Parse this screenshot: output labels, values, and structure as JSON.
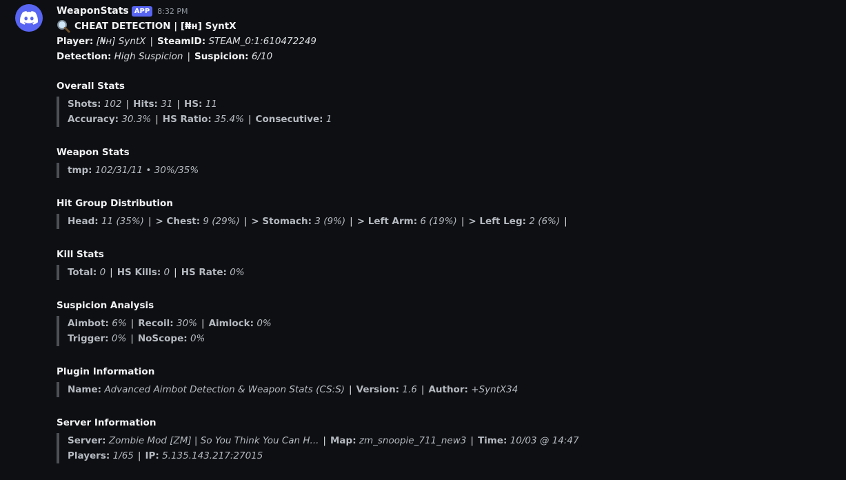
{
  "message": {
    "author": "WeaponStats",
    "badge": "APP",
    "timestamp": "8:32 PM",
    "title": "CHEAT DETECTION | [₦ʜ] SyntX",
    "player_label": "Player:",
    "player_value": "[₦ʜ] SyntX",
    "steamid_label": "SteamID:",
    "steamid_value": "STEAM_0:1:610472249",
    "detection_label": "Detection:",
    "detection_value": "High Suspicion",
    "suspicion_label": "Suspicion:",
    "suspicion_value": "6/10"
  },
  "overall": {
    "title": "Overall Stats",
    "shots_label": "Shots:",
    "shots": "102",
    "hits_label": "Hits:",
    "hits": "31",
    "hs_label": "HS:",
    "hs": "11",
    "accuracy_label": "Accuracy:",
    "accuracy": "30.3%",
    "hsratio_label": "HS Ratio:",
    "hsratio": "35.4%",
    "consecutive_label": "Consecutive:",
    "consecutive": "1"
  },
  "weapon": {
    "title": "Weapon Stats",
    "label": "tmp:",
    "value": "102/31/11 • 30%/35%"
  },
  "hitgroup": {
    "title": "Hit Group Distribution",
    "head_label": "Head:",
    "head": "11 (35%)",
    "chest_label": "> Chest:",
    "chest": "9 (29%)",
    "stomach_label": "> Stomach:",
    "stomach": "3 (9%)",
    "leftarm_label": "> Left Arm:",
    "leftarm": "6 (19%)",
    "leftleg_label": "> Left Leg:",
    "leftleg": "2 (6%)"
  },
  "kills": {
    "title": "Kill Stats",
    "total_label": "Total:",
    "total": "0",
    "hskills_label": "HS Kills:",
    "hskills": "0",
    "hsrate_label": "HS Rate:",
    "hsrate": "0%"
  },
  "suspicion": {
    "title": "Suspicion Analysis",
    "aimbot_label": "Aimbot:",
    "aimbot": "6%",
    "recoil_label": "Recoil:",
    "recoil": "30%",
    "aimlock_label": "Aimlock:",
    "aimlock": "0%",
    "trigger_label": "Trigger:",
    "trigger": "0%",
    "noscope_label": "NoScope:",
    "noscope": "0%"
  },
  "plugin": {
    "title": "Plugin Information",
    "name_label": "Name:",
    "name": "Advanced Aimbot Detection & Weapon Stats (CS:S)",
    "version_label": "Version:",
    "version": "1.6",
    "author_label": "Author:",
    "author": "+SyntX34"
  },
  "server": {
    "title": "Server Information",
    "server_label": "Server:",
    "server": "Zombie Mod [ZM] | So You Think You Can H...",
    "map_label": "Map:",
    "map": "zm_snoopie_711_new3",
    "time_label": "Time:",
    "time": "10/03 @ 14:47",
    "players_label": "Players:",
    "players": "1/65",
    "ip_label": "IP:",
    "ip": "5.135.143.217:27015"
  },
  "colors": {
    "accent": "#5865f2",
    "background": "#0e0f12",
    "quote_bar": "#4e5058"
  },
  "icons": {
    "avatar": "discord-icon",
    "title": "magnifying-glass-icon"
  }
}
